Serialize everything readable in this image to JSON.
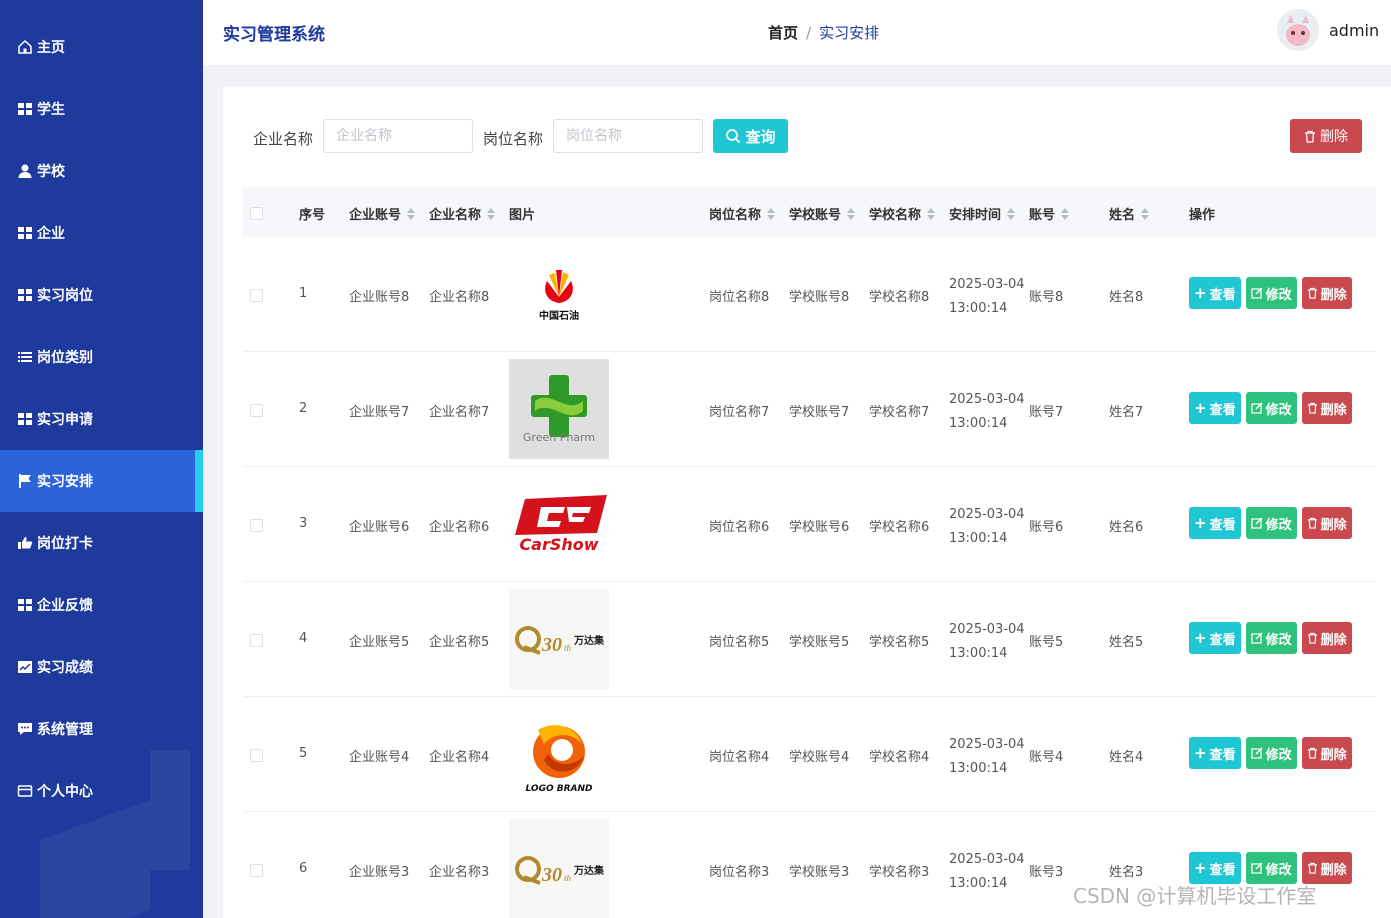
{
  "sidebar": {
    "items": [
      {
        "label": "主页",
        "icon": "home-icon"
      },
      {
        "label": "学生",
        "icon": "grid-icon"
      },
      {
        "label": "学校",
        "icon": "user-icon"
      },
      {
        "label": "企业",
        "icon": "grid-icon"
      },
      {
        "label": "实习岗位",
        "icon": "grid-icon"
      },
      {
        "label": "岗位类别",
        "icon": "list-icon"
      },
      {
        "label": "实习申请",
        "icon": "grid-icon"
      },
      {
        "label": "实习安排",
        "icon": "flag-icon",
        "active": true
      },
      {
        "label": "岗位打卡",
        "icon": "thumbs-up-icon"
      },
      {
        "label": "企业反馈",
        "icon": "grid-icon"
      },
      {
        "label": "实习成绩",
        "icon": "chart-icon"
      },
      {
        "label": "系统管理",
        "icon": "chat-icon"
      },
      {
        "label": "个人中心",
        "icon": "card-icon"
      }
    ]
  },
  "header": {
    "title": "实习管理系统",
    "breadcrumb_home": "首页",
    "breadcrumb_sep": "/",
    "breadcrumb_current": "实习安排",
    "username": "admin"
  },
  "search": {
    "company_label": "企业名称",
    "company_placeholder": "企业名称",
    "position_label": "岗位名称",
    "position_placeholder": "岗位名称",
    "query_button": "查询",
    "delete_button": "删除"
  },
  "table": {
    "headers": {
      "index": "序号",
      "company_account": "企业账号",
      "company_name": "企业名称",
      "image": "图片",
      "position_name": "岗位名称",
      "school_account": "学校账号",
      "school_name": "学校名称",
      "arrange_time": "安排时间",
      "account": "账号",
      "name": "姓名",
      "actions": "操作"
    },
    "actions": {
      "view": "查看",
      "edit": "修改",
      "delete": "删除"
    },
    "rows": [
      {
        "index": "1",
        "company_account": "企业账号8",
        "company_name": "企业名称8",
        "logo": "petrochina",
        "logo_text": "中国石油",
        "position_name": "岗位名称8",
        "school_account": "学校账号8",
        "school_name": "学校名称8",
        "date": "2025-03-04",
        "time": "13:00:14",
        "account": "账号8",
        "name": "姓名8"
      },
      {
        "index": "2",
        "company_account": "企业账号7",
        "company_name": "企业名称7",
        "logo": "greenpharm",
        "logo_text": "Green Pharm",
        "position_name": "岗位名称7",
        "school_account": "学校账号7",
        "school_name": "学校名称7",
        "date": "2025-03-04",
        "time": "13:00:14",
        "account": "账号7",
        "name": "姓名7"
      },
      {
        "index": "3",
        "company_account": "企业账号6",
        "company_name": "企业名称6",
        "logo": "carshow",
        "logo_text": "CarShow",
        "position_name": "岗位名称6",
        "school_account": "学校账号6",
        "school_name": "学校名称6",
        "date": "2025-03-04",
        "time": "13:00:14",
        "account": "账号6",
        "name": "姓名6"
      },
      {
        "index": "4",
        "company_account": "企业账号5",
        "company_name": "企业名称5",
        "logo": "wanda",
        "logo_text": "万达集",
        "position_name": "岗位名称5",
        "school_account": "学校账号5",
        "school_name": "学校名称5",
        "date": "2025-03-04",
        "time": "13:00:14",
        "account": "账号5",
        "name": "姓名5"
      },
      {
        "index": "5",
        "company_account": "企业账号4",
        "company_name": "企业名称4",
        "logo": "logobrand",
        "logo_text": "LOGO BRAND",
        "position_name": "岗位名称4",
        "school_account": "学校账号4",
        "school_name": "学校名称4",
        "date": "2025-03-04",
        "time": "13:00:14",
        "account": "账号4",
        "name": "姓名4"
      },
      {
        "index": "6",
        "company_account": "企业账号3",
        "company_name": "企业名称3",
        "logo": "wanda",
        "logo_text": "万达集",
        "position_name": "岗位名称3",
        "school_account": "学校账号3",
        "school_name": "学校名称3",
        "date": "2025-03-04",
        "time": "13:00:14",
        "account": "账号3",
        "name": "姓名3"
      }
    ]
  },
  "watermark": "CSDN @计算机毕设工作室",
  "colors": {
    "sidebar": "#1e3a9c",
    "active": "#2b63d9",
    "accent": "#25d0ee",
    "view": "#1ec7d3",
    "edit": "#2ec27e",
    "delete": "#c9494f"
  }
}
